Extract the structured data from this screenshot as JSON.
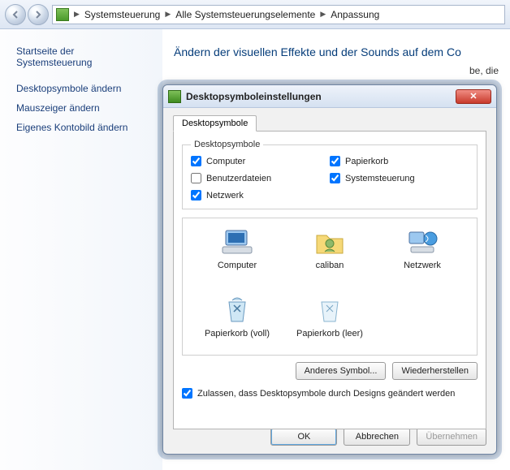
{
  "breadcrumb": {
    "items": [
      "Systemsteuerung",
      "Alle Systemsteuerungselemente",
      "Anpassung"
    ]
  },
  "sidebar": {
    "heading": "Startseite der Systemsteuerung",
    "links": [
      "Desktopsymbole ändern",
      "Mauszeiger ändern",
      "Eigenes Kontobild ändern"
    ]
  },
  "content": {
    "heading": "Ändern der visuellen Effekte und der Sounds auf dem Co",
    "subtext_fragment": "be, die"
  },
  "dialog": {
    "title": "Desktopsymboleinstellungen",
    "tab_label": "Desktopsymbole",
    "group_legend": "Desktopsymbole",
    "checks": {
      "left": [
        {
          "label": "Computer",
          "checked": true
        },
        {
          "label": "Benutzerdateien",
          "checked": false
        },
        {
          "label": "Netzwerk",
          "checked": true
        }
      ],
      "right": [
        {
          "label": "Papierkorb",
          "checked": true
        },
        {
          "label": "Systemsteuerung",
          "checked": true
        }
      ]
    },
    "icons": [
      {
        "label": "Computer",
        "name": "computer-icon"
      },
      {
        "label": "caliban",
        "name": "user-folder-icon"
      },
      {
        "label": "Netzwerk",
        "name": "network-icon"
      },
      {
        "label": "Papierkorb (voll)",
        "name": "recycle-full-icon"
      },
      {
        "label": "Papierkorb (leer)",
        "name": "recycle-empty-icon"
      }
    ],
    "buttons": {
      "change": "Anderes Symbol...",
      "restore": "Wiederherstellen"
    },
    "allow_label": "Zulassen, dass Desktopsymbole durch Designs geändert werden",
    "allow_checked": true,
    "footer": {
      "ok": "OK",
      "cancel": "Abbrechen",
      "apply": "Übernehmen"
    }
  }
}
